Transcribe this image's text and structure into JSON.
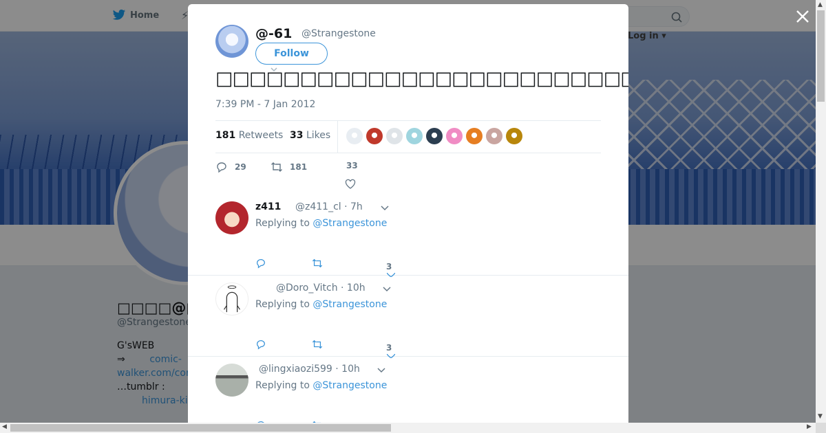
{
  "nav": {
    "home_label": "Home",
    "login_label": "Log in"
  },
  "profile": {
    "name": "□□□□@□□□",
    "handle": "@Strangestone",
    "bio_lines": [
      "G'sWEB",
      "⇒",
      "comic-",
      "walker.com/cor",
      "…tumblr :",
      "himura-ki"
    ]
  },
  "modal": {
    "author_name": "@-61",
    "author_handle": "@Strangestone",
    "follow_label": "Follow",
    "tweet_text": "□□□□□□□□□□□□□□□□□□□□□□□□□□□□□□□□□□□□□□□□□□□□□□□□□□□□□□□□□□□□□□□□□",
    "timestamp": "7:39 PM - 7 Jan 2012",
    "retweets_count": "181",
    "retweets_label": "Retweets",
    "likes_count": "33",
    "likes_label": "Likes",
    "liker_colors": [
      "#e8edf2",
      "#c0392b",
      "#dfe4e8",
      "#9fd5df",
      "#2c3e50",
      "#f08cc4",
      "#e67e22",
      "#c9a5a0",
      "#b8860b"
    ],
    "action_counts": {
      "replies": "29",
      "retweets": "181",
      "likes": "33"
    }
  },
  "replies": [
    {
      "name": "z411",
      "handle": "@z411_cl",
      "age": "· 7h",
      "replying_prefix": "Replying to",
      "mention": "@Strangestone",
      "likes": "3",
      "avatar_color": "#b3262d"
    },
    {
      "name": "",
      "handle": "@Doro_Vitch",
      "age": "· 10h",
      "replying_prefix": "Replying to",
      "mention": "@Strangestone",
      "likes": "3",
      "avatar_color": "#ffffff"
    },
    {
      "name": "",
      "handle": "@lingxiaozi599",
      "age": "· 10h",
      "replying_prefix": "Replying to",
      "mention": "@Strangestone",
      "likes": "",
      "avatar_color": "#7f8c7f"
    }
  ]
}
